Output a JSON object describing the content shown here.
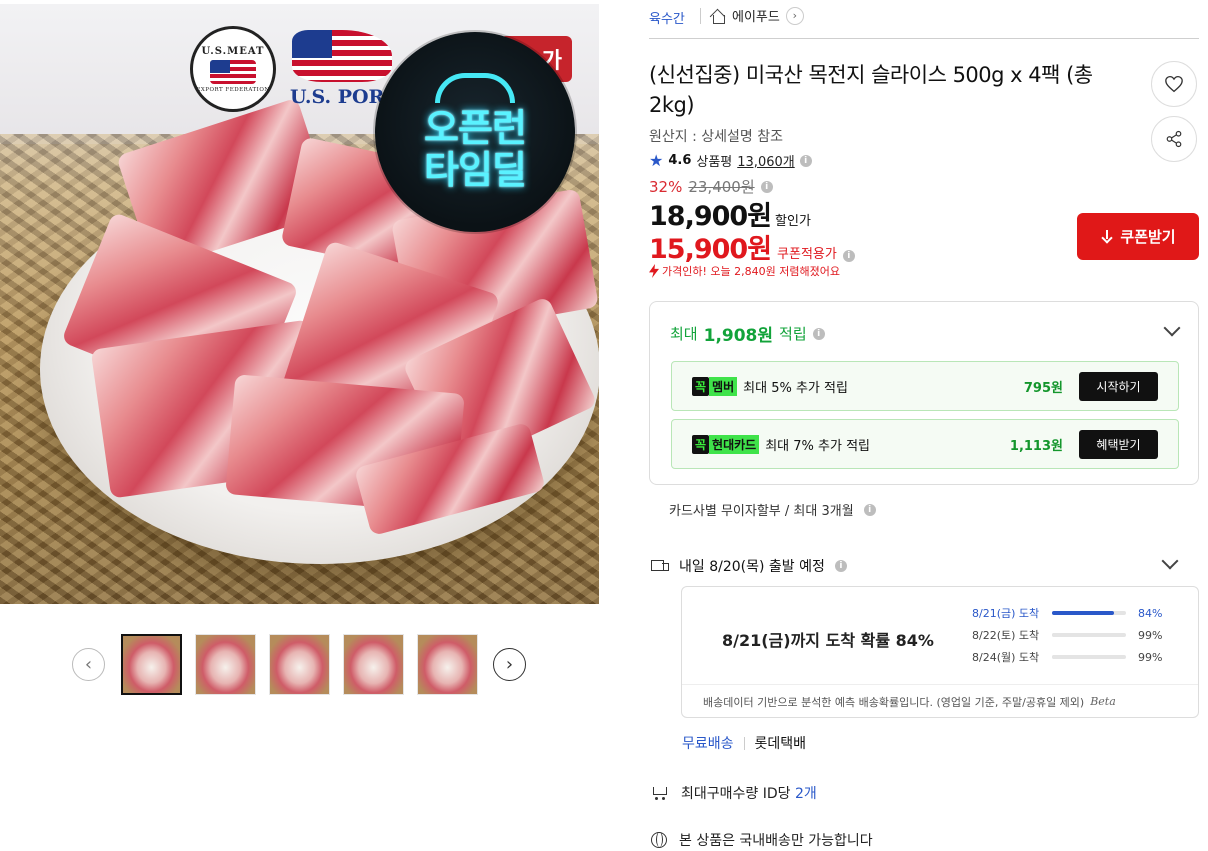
{
  "image": {
    "logo_meat_top": "U.S.MEAT",
    "logo_meat_bottom": "EXPORT FEDERATION",
    "logo_pork": "U.S. PORK",
    "deal_badge_line1": "오픈런",
    "deal_badge_line2": "타임딜",
    "red_tag": "가"
  },
  "thumbnails": {
    "count": 5,
    "active_index": 0
  },
  "breadcrumb": {
    "category": "육수간",
    "store": "에이푸드"
  },
  "product": {
    "title": "(신선집중) 미국산 목전지 슬라이스 500g x 4팩 (총 2kg)",
    "origin": "원산지 : 상세설명 참조",
    "rating": "4.6",
    "review_label": "상품평",
    "review_count": "13,060개"
  },
  "price": {
    "discount_pct": "32%",
    "original": "23,400원",
    "sale": "18,900원",
    "sale_label": "할인가",
    "coupon": "15,900원",
    "coupon_label": "쿠폰적용가",
    "price_drop": "가격인하! 오늘 2,840원 저렴해졌어요",
    "coupon_button": "쿠폰받기"
  },
  "rewards": {
    "head_prefix": "최대",
    "head_amount": "1,908원",
    "head_suffix": "적립",
    "items": [
      {
        "badge": "꼭",
        "tag": "멤버",
        "desc": "최대 5% 추가 적립",
        "value": "795원",
        "button": "시작하기"
      },
      {
        "badge": "꼭",
        "tag": "현대카드",
        "desc": "최대 7% 추가 적립",
        "value": "1,113원",
        "button": "혜택받기"
      }
    ]
  },
  "installment": "카드사별 무이자할부 / 최대 3개월",
  "shipping": {
    "headline": "내일 8/20(목) 출발 예정",
    "arrival_summary": "8/21(금)까지 도착 확률 84%",
    "probabilities": [
      {
        "label": "8/21(금) 도착",
        "pct": 84,
        "pct_text": "84%"
      },
      {
        "label": "8/22(토) 도착",
        "pct": 99,
        "pct_text": "99%"
      },
      {
        "label": "8/24(월) 도착",
        "pct": 99,
        "pct_text": "99%"
      }
    ],
    "note": "배송데이터 기반으로 분석한 예측 배송확률입니다. (영업일 기준, 주말/공휴일 제외)",
    "beta": "Beta",
    "free_label": "무료배송",
    "carrier": "롯데택배"
  },
  "limits": {
    "max_purchase_prefix": "최대구매수량 ID당",
    "max_purchase_value": "2개",
    "domestic_only": "본 상품은 국내배송만 가능합니다"
  },
  "colors": {
    "accent_blue": "#2a58c9",
    "price_red": "#e0181e",
    "reward_green": "#12a33a"
  }
}
